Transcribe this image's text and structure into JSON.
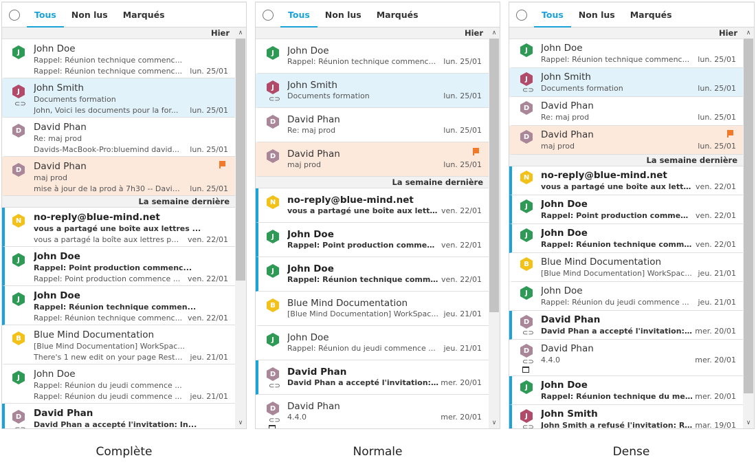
{
  "tabs": {
    "all": "Tous",
    "unread": "Non lus",
    "flagged": "Marqués"
  },
  "groups": {
    "yesterday": "Hier",
    "lastweek": "La semaine dernière"
  },
  "captions": {
    "complete": "Complète",
    "normal": "Normale",
    "dense": "Dense"
  },
  "complete": {
    "m1": {
      "avatar": "J",
      "name": "John Doe",
      "l2": "Rappel: Réunion technique commenc...",
      "l3": "Rappel: Réunion technique commenc...",
      "date": "lun. 25/01"
    },
    "m2": {
      "avatar": "J",
      "name": "John Smith",
      "l2": "Documents formation",
      "l3": "John, Voici les documents pour la for...",
      "date": "lun. 25/01"
    },
    "m3": {
      "avatar": "D",
      "name": "David Phan",
      "l2": "Re: maj prod",
      "l3": "Davids-MacBook-Pro:bluemind david...",
      "date": "lun. 25/01"
    },
    "m4": {
      "avatar": "D",
      "name": "David Phan",
      "l2": "maj prod",
      "l3": "mise à jour de la prod à 7h30 -- David ...",
      "date": "lun. 25/01"
    },
    "m5": {
      "avatar": "N",
      "name": "no-reply@blue-mind.net",
      "l2": "vous a partagé une boîte aux lettres ...",
      "l3": "vous a partagé la boîte aux lettres par...",
      "date": "ven. 22/01"
    },
    "m6": {
      "avatar": "J",
      "name": "John Doe",
      "l2": "Rappel: Point production commenc...",
      "l3": "Rappel: Point production commence ...",
      "date": "ven. 22/01"
    },
    "m7": {
      "avatar": "J",
      "name": "John Doe",
      "l2": "Rappel: Réunion technique commen...",
      "l3": "Rappel: Réunion technique commenc...",
      "date": "ven. 22/01"
    },
    "m8": {
      "avatar": "B",
      "name": "Blue Mind Documentation",
      "l2": "[Blue Mind Documentation] WorkSpac...",
      "l3": "There's 1 new edit on your page Restau...",
      "date": "jeu. 21/01"
    },
    "m9": {
      "avatar": "J",
      "name": "John Doe",
      "l2": "Rappel: Réunion du jeudi commence ...",
      "l3": "Rappel: Réunion du jeudi commence ...",
      "date": "jeu. 21/01"
    },
    "m10": {
      "avatar": "D",
      "name": "David Phan",
      "l2": "David Phan a accepté l'invitation: In...",
      "l3": "",
      "date": ""
    }
  },
  "normal": {
    "m1": {
      "avatar": "J",
      "name": "John Doe",
      "l2": "Rappel: Réunion technique commenc...",
      "date": "lun. 25/01"
    },
    "m2": {
      "avatar": "J",
      "name": "John Smith",
      "l2": "Documents formation",
      "date": "lun. 25/01"
    },
    "m3": {
      "avatar": "D",
      "name": "David Phan",
      "l2": "Re: maj prod",
      "date": "lun. 25/01"
    },
    "m4": {
      "avatar": "D",
      "name": "David Phan",
      "l2": "maj prod",
      "date": "lun. 25/01"
    },
    "m5": {
      "avatar": "N",
      "name": "no-reply@blue-mind.net",
      "l2": "vous a partagé une boîte aux lettres ...",
      "date": "ven. 22/01"
    },
    "m6": {
      "avatar": "J",
      "name": "John Doe",
      "l2": "Rappel: Point production commenc...",
      "date": "ven. 22/01"
    },
    "m7": {
      "avatar": "J",
      "name": "John Doe",
      "l2": "Rappel: Réunion technique commen...",
      "date": "ven. 22/01"
    },
    "m8": {
      "avatar": "B",
      "name": "Blue Mind Documentation",
      "l2": "[Blue Mind Documentation] WorkSpac...",
      "date": "jeu. 21/01"
    },
    "m9": {
      "avatar": "J",
      "name": "John Doe",
      "l2": "Rappel: Réunion du jeudi commence ...",
      "date": "jeu. 21/01"
    },
    "m10": {
      "avatar": "D",
      "name": "David Phan",
      "l2": "David Phan a accepté l'invitation: In...",
      "date": "mer. 20/01"
    },
    "m11": {
      "avatar": "D",
      "name": "David Phan",
      "l2": "4.4.0",
      "date": "mer. 20/01"
    }
  },
  "dense": {
    "m1": {
      "avatar": "J",
      "name": "John Doe",
      "l2": "Rappel: Réunion technique commenc...",
      "date": "lun. 25/01"
    },
    "m2": {
      "avatar": "J",
      "name": "John Smith",
      "l2": "Documents formation",
      "date": "lun. 25/01"
    },
    "m3": {
      "avatar": "D",
      "name": "David Phan",
      "l2": "Re: maj prod",
      "date": "lun. 25/01"
    },
    "m4": {
      "avatar": "D",
      "name": "David Phan",
      "l2": "maj prod",
      "date": "lun. 25/01"
    },
    "m5": {
      "avatar": "N",
      "name": "no-reply@blue-mind.net",
      "l2": "vous a partagé une boîte aux lettres ...",
      "date": "ven. 22/01"
    },
    "m6": {
      "avatar": "J",
      "name": "John Doe",
      "l2": "Rappel: Point production commenc...",
      "date": "ven. 22/01"
    },
    "m7": {
      "avatar": "J",
      "name": "John Doe",
      "l2": "Rappel: Réunion technique commen...",
      "date": "ven. 22/01"
    },
    "m8": {
      "avatar": "B",
      "name": "Blue Mind Documentation",
      "l2": "[Blue Mind Documentation] WorkSpac...",
      "date": "jeu. 21/01"
    },
    "m9": {
      "avatar": "J",
      "name": "John Doe",
      "l2": "Rappel: Réunion du jeudi commence ...",
      "date": "jeu. 21/01"
    },
    "m10": {
      "avatar": "D",
      "name": "David Phan",
      "l2": "David Phan a accepté l'invitation: In...",
      "date": "mer. 20/01"
    },
    "m11": {
      "avatar": "D",
      "name": "David Phan",
      "l2": "4.4.0",
      "date": "mer. 20/01"
    },
    "m12": {
      "avatar": "J",
      "name": "John Doe",
      "l2": "Rappel: Réunion technique du merc...",
      "date": "mer. 20/01"
    },
    "m13": {
      "avatar": "J",
      "name": "John Smith",
      "l2": "John Smith a refusé l'invitation: Réu...",
      "date": "mar. 19/01"
    }
  },
  "icons": {
    "attachment": "paperclip-icon",
    "event": "calendar-icon",
    "flag": "flag-icon",
    "scroll_up": "chevron-up-icon",
    "scroll_down": "chevron-down-icon"
  },
  "colors": {
    "accent": "#1aa3d9",
    "selected": "#e2f2fa",
    "flagged": "#fde9dc",
    "flag": "#f07a2a"
  }
}
